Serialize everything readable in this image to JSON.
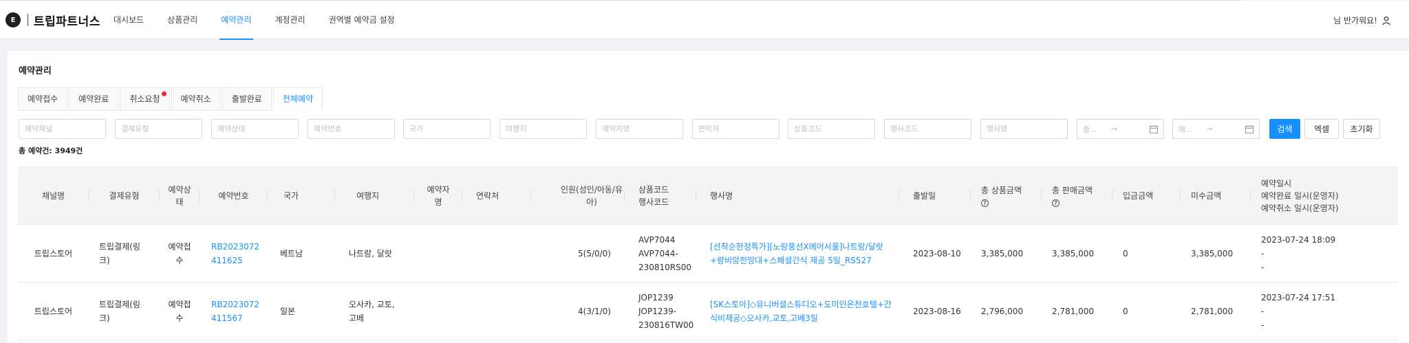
{
  "header": {
    "logo_letter": "E",
    "brand": "트립파트너스",
    "nav": [
      "대시보드",
      "상품관리",
      "예약관리",
      "계정관리",
      "권역별 예약금 설정"
    ],
    "active_nav": 2,
    "greeting": "님 반가워요!",
    "user_icon": "user-icon"
  },
  "page": {
    "title": "예약관리",
    "tabs": [
      "예약접수",
      "예약완료",
      "취소요청",
      "예약취소",
      "출발완료",
      "전체예약"
    ],
    "active_tab": 5,
    "tab_with_badge": 2,
    "total_count": "총 예약건: 3949건"
  },
  "filters": {
    "placeholders": [
      "예약채널",
      "결제유형",
      "예약상태",
      "예약번호",
      "국가",
      "여행지",
      "예약자명",
      "연락처",
      "상품코드",
      "행사코드",
      "행사명"
    ],
    "date1_placeholder": "출...",
    "date2_placeholder": "예...",
    "date_arrow": "→",
    "search_label": "검색",
    "excel_label": "엑셀",
    "reset_label": "초기화"
  },
  "table": {
    "columns": {
      "channel": "채널명",
      "pay_type": "결제유형",
      "status_l1": "예약상",
      "status_l2": "태",
      "res_no": "예약번호",
      "country": "국가",
      "destination": "여행지",
      "booker_l1": "예약자",
      "booker_l2": "명",
      "contact": "연락처",
      "people_l1": "인원(성인/아동/유",
      "people_l2": "아)",
      "code_l1": "상품코드",
      "code_l2": "행사코드",
      "event_name": "행사명",
      "departure": "출발일",
      "total_product": "총 상품금액",
      "total_sale": "총 판매금액",
      "deposit": "입금금액",
      "unpaid": "미수금액",
      "dates_l1": "예약일시",
      "dates_l2": "예약완료 일시(운영자)",
      "dates_l3": "예약취소 일시(운영자)"
    },
    "rows": [
      {
        "channel": "트립스토어",
        "pay_l1": "트립결제(링",
        "pay_l2": "크)",
        "status_l1": "예약접",
        "status_l2": "수",
        "res_l1": "RB2023072",
        "res_l2": "411625",
        "country": "베트남",
        "destination_l1": "나트랑, 달랏",
        "destination_l2": "",
        "people": "5(5/0/0)",
        "code_l1": "AVP7044",
        "code_l2": "AVP7044-",
        "code_l3": "230810RS00",
        "event_l1": "[선착순한정특가][노랑풍선X에어서울]나트랑/달랏",
        "event_l2": "+랑비앙전망대+스페셜간식 제공 5일_RS527",
        "departure": "2023-08-10",
        "total_product": "3,385,000",
        "total_sale": "3,385,000",
        "deposit": "0",
        "unpaid": "3,385,000",
        "date_l1": "2023-07-24 18:09",
        "date_l2": "-",
        "date_l3": "-"
      },
      {
        "channel": "트립스토어",
        "pay_l1": "트립결제(링",
        "pay_l2": "크)",
        "status_l1": "예약접",
        "status_l2": "수",
        "res_l1": "RB2023072",
        "res_l2": "411567",
        "country": "일본",
        "destination_l1": "오사카, 교토,",
        "destination_l2": "고베",
        "people": "4(3/1/0)",
        "code_l1": "JOP1239",
        "code_l2": "JOP1239-",
        "code_l3": "230816TW00",
        "event_l1": "[SK스토아]◇유니버셜스튜디오+도미인온천호텔+간",
        "event_l2": "식비제공◇오사카,교토,고베3일",
        "departure": "2023-08-16",
        "total_product": "2,796,000",
        "total_sale": "2,781,000",
        "deposit": "0",
        "unpaid": "2,781,000",
        "date_l1": "2023-07-24 17:51",
        "date_l2": "-",
        "date_l3": "-"
      }
    ]
  },
  "colors": {
    "accent": "#1890ff",
    "badge": "#f5222d",
    "header_bg": "#f4f4f4"
  }
}
